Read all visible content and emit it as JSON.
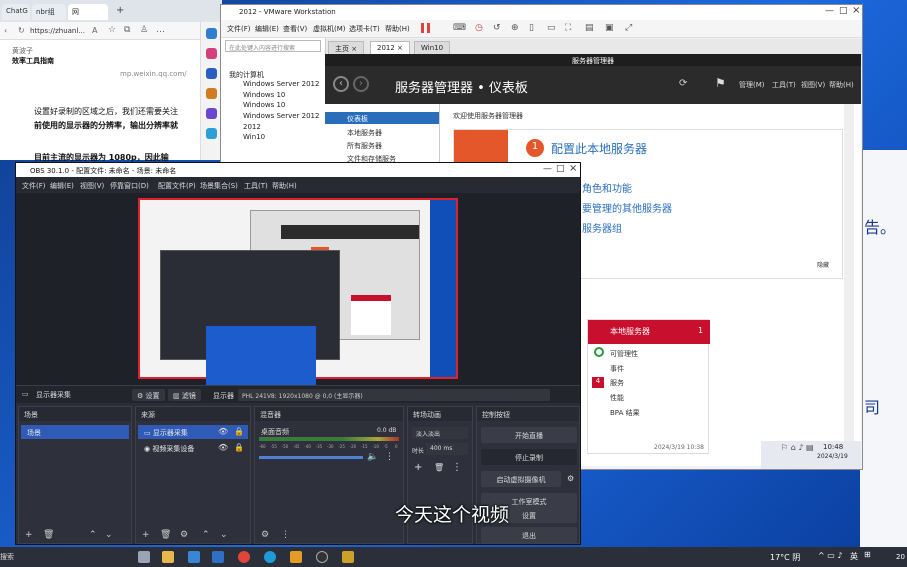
{
  "browser": {
    "tabs": [
      "ChatG",
      "nbr组",
      "网"
    ],
    "address": "https://zhuanl...",
    "article_author": "黄波子",
    "article_title": "效率工具指南",
    "source_url": "mp.weixin.qq.com/",
    "para1": "设置好录制的区域之后，我们还需要关注",
    "para2": "前使用的显示器的分辨率，输出分辨率就",
    "para3": "目前主流的显示器为 1080p，因此输"
  },
  "vmware": {
    "title": "2012 - VMware Workstation",
    "menu": [
      "文件(F)",
      "编辑(E)",
      "查看(V)",
      "虚拟机(M)",
      "选项卡(T)",
      "帮助(H)"
    ],
    "tabs": [
      "主页",
      "2012",
      "Win10"
    ],
    "search_placeholder": "在此处键入内容进行搜索",
    "library_root": "我的计算机",
    "library_items": [
      "Windows Server 2012",
      "Windows 10",
      "Windows 10",
      "Windows Server 2012",
      "2012",
      "Win10"
    ]
  },
  "server_manager": {
    "window_title": "服务器管理器",
    "heading": "服务器管理器 • 仪表板",
    "top_menu": [
      "管理(M)",
      "工具(T)",
      "视图(V)",
      "帮助(H)"
    ],
    "nav": [
      "仪表板",
      "本地服务器",
      "所有服务器",
      "文件和存储服务"
    ],
    "welcome": "欢迎使用服务器管理器",
    "step_number": "1",
    "step_text": "配置此本地服务器",
    "links": [
      "角色和功能",
      "要管理的其他服务器",
      "服务器组"
    ],
    "hide": "隐藏",
    "tile_title": "本地服务器",
    "tile_count": "1",
    "tile_rows": [
      "可管理性",
      "事件",
      "服务",
      "性能",
      "BPA 结果"
    ],
    "tile_service_count": "4",
    "tile_time": "2024/3/19 10:38",
    "vm_time": "10:48",
    "vm_date": "2024/3/19"
  },
  "obs": {
    "title": "OBS 30.1.0 - 配置文件: 未命名 - 场景: 未命名",
    "menu": [
      "文件(F)",
      "编辑(E)",
      "视图(V)",
      "停靠窗口(D)",
      "配置文件(P)",
      "场景集合(S)",
      "工具(T)",
      "帮助(H)"
    ],
    "source_label": "显示器采集",
    "btn_settings": "设置",
    "btn_filters": "滤镜",
    "display_label": "显示器",
    "display_value": "PHL 241V8: 1920x1080 @ 0,0 (主显示器)",
    "scenes_title": "场景",
    "scene": "场景",
    "sources_title": "来源",
    "sources": [
      "显示器采集",
      "视频采集设备"
    ],
    "mixer_title": "混音器",
    "mixer_track": "桌面音频",
    "mixer_db": "0.0 dB",
    "transitions_title": "转场动画",
    "transition": "淡入淡出",
    "duration_label": "时长",
    "duration_value": "400 ms",
    "controls_title": "控制按钮",
    "controls": [
      "开始直播",
      "停止录制",
      "启动虚拟摄像机",
      "工作室模式",
      "设置",
      "退出"
    ],
    "scale_ticks": [
      "-60",
      "-55",
      "-50",
      "-45",
      "-40",
      "-35",
      "-30",
      "-25",
      "-20",
      "-15",
      "-10",
      "-5",
      "0"
    ]
  },
  "subtitle": "今天这个视频",
  "taskbar": {
    "search": "搜索",
    "weather": "17°C 阴",
    "ime": "英",
    "clock_year": "20"
  },
  "right_glyphs": [
    "告。",
    "司"
  ]
}
